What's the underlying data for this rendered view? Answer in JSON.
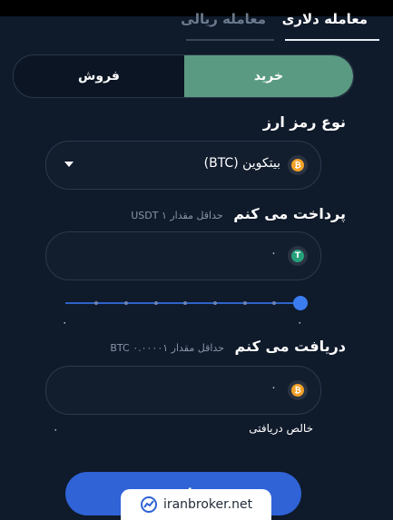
{
  "tabs": {
    "dollar_label": "معامله دلاری",
    "rial_label": "معامله ریالی"
  },
  "toggle": {
    "buy_label": "خرید",
    "sell_label": "فروش"
  },
  "crypto_type": {
    "label": "نوع رمز ارز",
    "selected": "بیتکوین (BTC)"
  },
  "pay": {
    "label": "پرداخت می کنم",
    "hint": "حداقل مقدار ۱ USDT",
    "value": "۰"
  },
  "slider": {
    "value_percent": 100,
    "min_label": "۰",
    "max_label": "۰"
  },
  "receive": {
    "label": "دریافت می کنم",
    "hint": "حداقل مقدار ۰.۰۰۰۰۱ BTC",
    "value": "۰"
  },
  "net_received": {
    "label": "خالص دریافتی",
    "value": "۰"
  },
  "submit": {
    "label": "تایید"
  },
  "watermark": {
    "text": "iranbroker.net"
  },
  "colors": {
    "background": "#0f1a2b",
    "buy_active": "#5b9a82",
    "accent_blue": "#2f63d6",
    "btc": "#f3a127",
    "usdt": "#26a17b"
  }
}
